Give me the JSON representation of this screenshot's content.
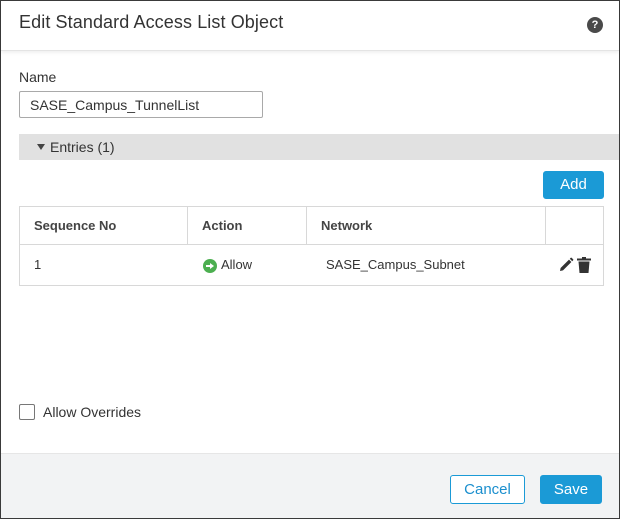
{
  "dialog": {
    "title": "Edit Standard Access List Object",
    "help_icon": "question-circle-icon"
  },
  "name_field": {
    "label": "Name",
    "value": "SASE_Campus_TunnelList"
  },
  "entries": {
    "label": "Entries (1)",
    "add_label": "Add",
    "columns": [
      "Sequence No",
      "Action",
      "Network",
      ""
    ],
    "rows": [
      {
        "sequence": "1",
        "action": "Allow",
        "network": "SASE_Campus_Subnet"
      }
    ]
  },
  "overrides": {
    "label": "Allow Overrides",
    "checked": false
  },
  "footer": {
    "cancel_label": "Cancel",
    "save_label": "Save"
  },
  "colors": {
    "primary": "#1b9ad6",
    "allow": "#4caf50",
    "footer_bg": "#f2f3f4"
  }
}
